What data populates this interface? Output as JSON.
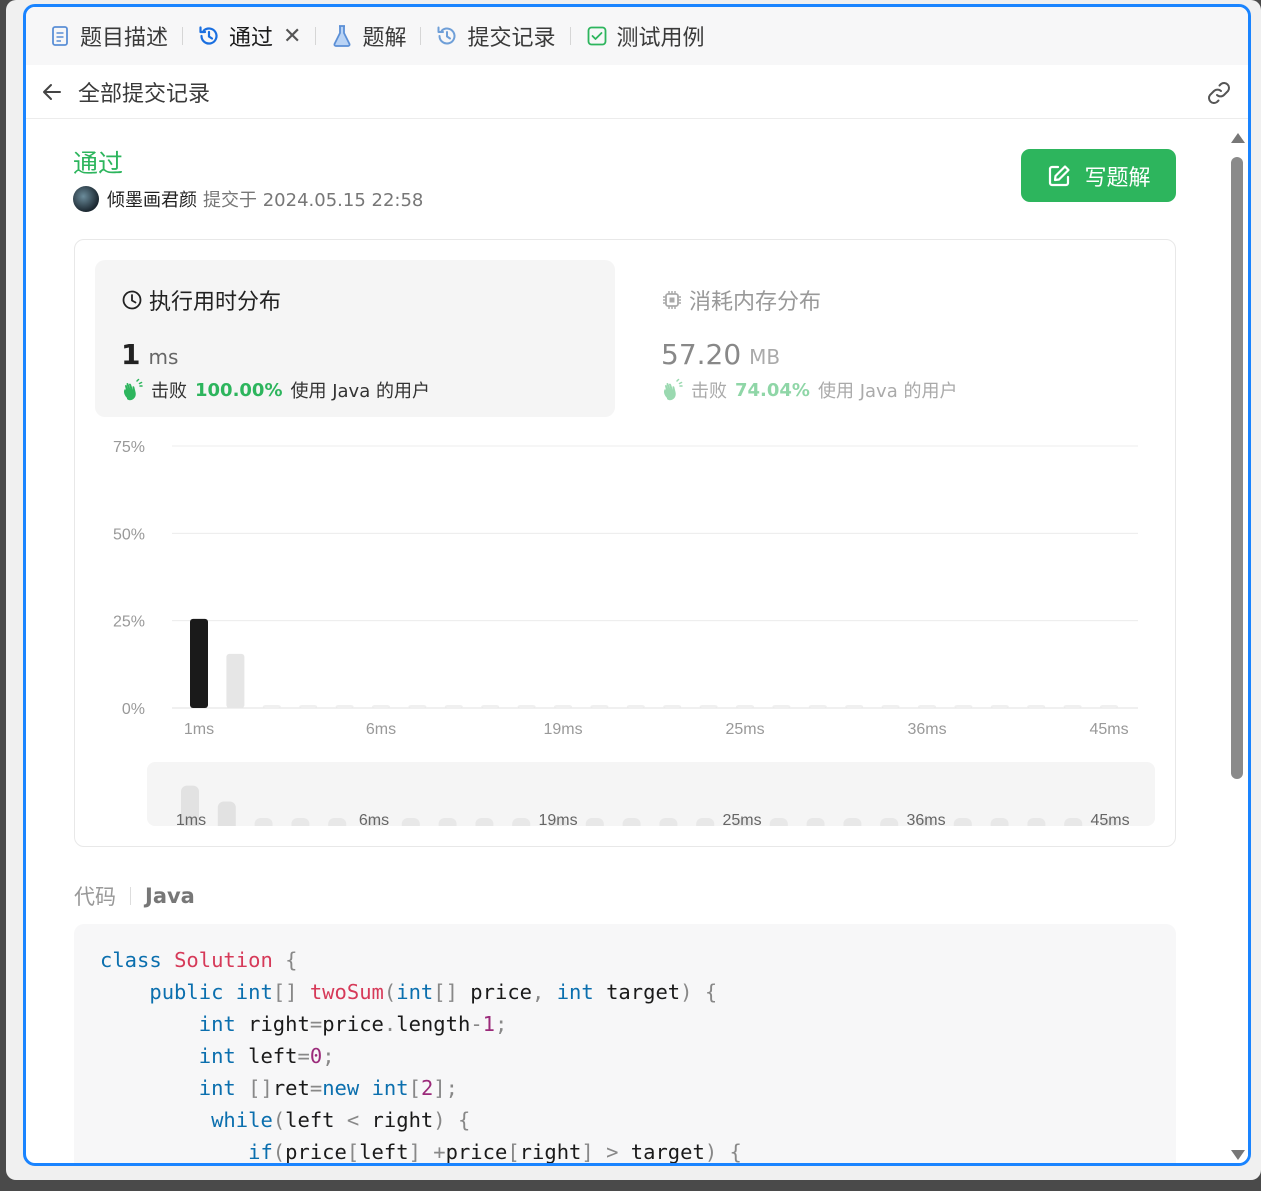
{
  "tabs": [
    {
      "label": "题目描述",
      "icon": "document-icon"
    },
    {
      "label": "通过",
      "icon": "history-icon"
    },
    {
      "label": "题解",
      "icon": "flask-icon"
    },
    {
      "label": "提交记录",
      "icon": "history-icon"
    },
    {
      "label": "测试用例",
      "icon": "checkbox-icon"
    }
  ],
  "colors": {
    "accent": "#1a84ff",
    "success": "#2db55d",
    "bar_active": "#1a1a1a",
    "bar_inactive": "#e6e6e6"
  },
  "subheader": {
    "title": "全部提交记录"
  },
  "submission": {
    "status": "通过",
    "user": "倾墨画君颜",
    "submitted_text": "提交于 2024.05.15 22:58"
  },
  "write_button": {
    "label": "写题解"
  },
  "runtime": {
    "title": "执行用时分布",
    "value": "1",
    "unit": "ms",
    "beat_prefix": "击败",
    "beat_pct": "100.00%",
    "beat_suffix": "使用 Java 的用户"
  },
  "memory": {
    "title": "消耗内存分布",
    "value": "57.20",
    "unit": "MB",
    "beat_prefix": "击败",
    "beat_pct": "74.04%",
    "beat_suffix": "使用 Java 的用户"
  },
  "chart_data": {
    "type": "bar",
    "x_tick_labels": [
      "1ms",
      "6ms",
      "19ms",
      "25ms",
      "36ms",
      "45ms"
    ],
    "y_tick_labels": [
      "75%",
      "50%",
      "25%",
      "0%"
    ],
    "ylim": [
      0,
      75
    ],
    "values": [
      25.5,
      15.5,
      0.5,
      0.5,
      0.5,
      0.5,
      0.5,
      0.5,
      0.5,
      0.5,
      0.5,
      0.5,
      0.5,
      0.5,
      0.5,
      0.5,
      0.5,
      0.5,
      0.5,
      0.5,
      0.5,
      0.5,
      0.5,
      0.5,
      0.5,
      0.5
    ],
    "highlight_index": 0,
    "grid": true
  },
  "code": {
    "label": "代码",
    "language": "Java"
  }
}
